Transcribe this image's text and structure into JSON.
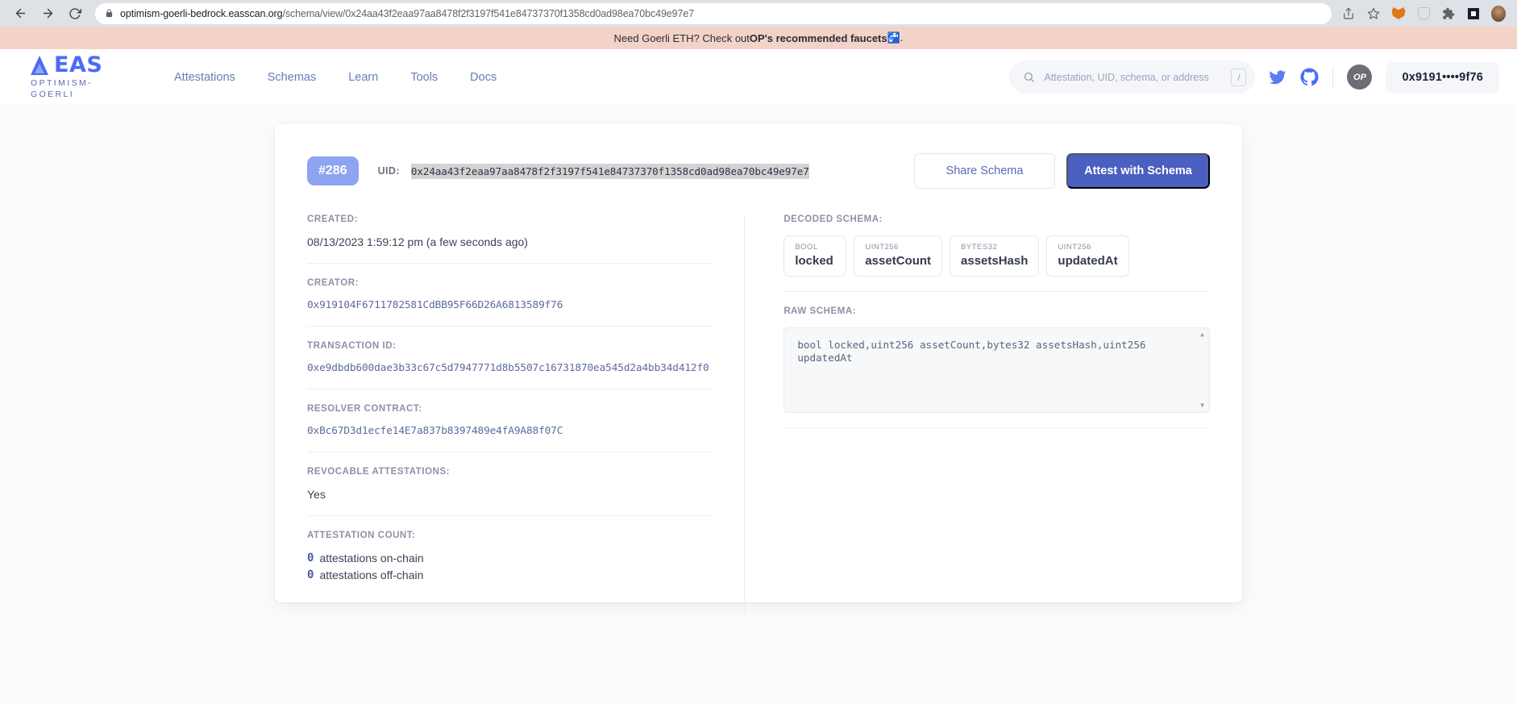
{
  "browser": {
    "back_icon": "back-arrow",
    "forward_icon": "forward-arrow",
    "reload_icon": "reload",
    "url_protocol_host": "optimism-goerli-bedrock.easscan.org",
    "url_path": "/schema/view/0x24aa43f2eaa97aa8478f2f3197f541e84737370f1358cd0ad98ea70bc49e97e7",
    "share_icon": "share",
    "bookmark_icon": "star",
    "extensions": [
      "metamask-fox-icon",
      "shield-extension-icon",
      "puzzle-extensions-icon",
      "square-extension-icon"
    ],
    "profile_icon": "profile-avatar"
  },
  "banner": {
    "text_before": "Need Goerli ETH? Check out ",
    "text_bold": "OP's recommended faucets",
    "text_after": " 🚰."
  },
  "header": {
    "logo_text": "EAS",
    "logo_subtitle": "OPTIMISM-GOERLI",
    "nav": [
      {
        "label": "Attestations"
      },
      {
        "label": "Schemas"
      },
      {
        "label": "Learn"
      },
      {
        "label": "Tools"
      },
      {
        "label": "Docs"
      }
    ],
    "search": {
      "placeholder": "Attestation, UID, schema, or address",
      "shortcut_key": "/"
    },
    "twitter_icon": "twitter-icon",
    "github_icon": "github-icon",
    "network_badge": "OP",
    "wallet_address": "0x9191••••9f76"
  },
  "schema": {
    "id_chip": "#286",
    "uid_label": "UID:",
    "uid_value": "0x24aa43f2eaa97aa8478f2f3197f541e84737370f1358cd0ad98ea70bc49e97e7",
    "share_button": "Share Schema",
    "attest_button": "Attest with Schema",
    "fields": [
      {
        "label": "CREATED:",
        "value": "08/13/2023 1:59:12 pm (a few seconds ago)",
        "mono": false
      },
      {
        "label": "CREATOR:",
        "value": "0x919104F6711782581CdBB95F66D26A6813589f76",
        "mono": true
      },
      {
        "label": "TRANSACTION ID:",
        "value": "0xe9dbdb600dae3b33c67c5d7947771d8b5507c16731870ea545d2a4bb34d412f0",
        "mono": true
      },
      {
        "label": "RESOLVER CONTRACT:",
        "value": "0xBc67D3d1ecfe14E7a837b8397489e4fA9A88f07C",
        "mono": true
      },
      {
        "label": "REVOCABLE ATTESTATIONS:",
        "value": "Yes",
        "mono": false
      }
    ],
    "attestation_count": {
      "label": "ATTESTATION COUNT:",
      "on_chain_num": "0",
      "on_chain_text": "attestations on-chain",
      "off_chain_num": "0",
      "off_chain_text": "attestations off-chain"
    },
    "decoded_schema": {
      "label": "DECODED SCHEMA:",
      "entries": [
        {
          "type": "BOOL",
          "name": "locked"
        },
        {
          "type": "UINT256",
          "name": "assetCount"
        },
        {
          "type": "BYTES32",
          "name": "assetsHash"
        },
        {
          "type": "UINT256",
          "name": "updatedAt"
        }
      ]
    },
    "raw_schema": {
      "label": "RAW SCHEMA:",
      "value": "bool locked,uint256 assetCount,bytes32 assetsHash,uint256 updatedAt"
    }
  },
  "colors": {
    "accent": "#4a6cf7",
    "primary_button": "#4a5fc1",
    "chip": "#8da4f0",
    "banner": "#f3d3c8"
  }
}
